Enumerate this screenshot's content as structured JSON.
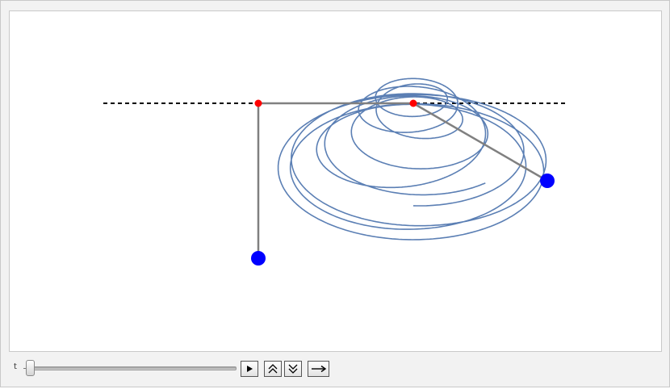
{
  "controls": {
    "slider_label": "t",
    "slider_value": 0.0,
    "buttons": [
      {
        "name": "play",
        "icon": "play-icon"
      },
      {
        "name": "faster",
        "icon": "double-chevron-up-icon"
      },
      {
        "name": "slower",
        "icon": "double-chevron-down-icon"
      },
      {
        "name": "direction",
        "icon": "right-arrow-icon"
      }
    ]
  },
  "colors": {
    "trace": "#5b7fb4",
    "pivot": "#ff0000",
    "bob": "#0000ff",
    "rod": "#808080",
    "track": "#000000"
  }
}
